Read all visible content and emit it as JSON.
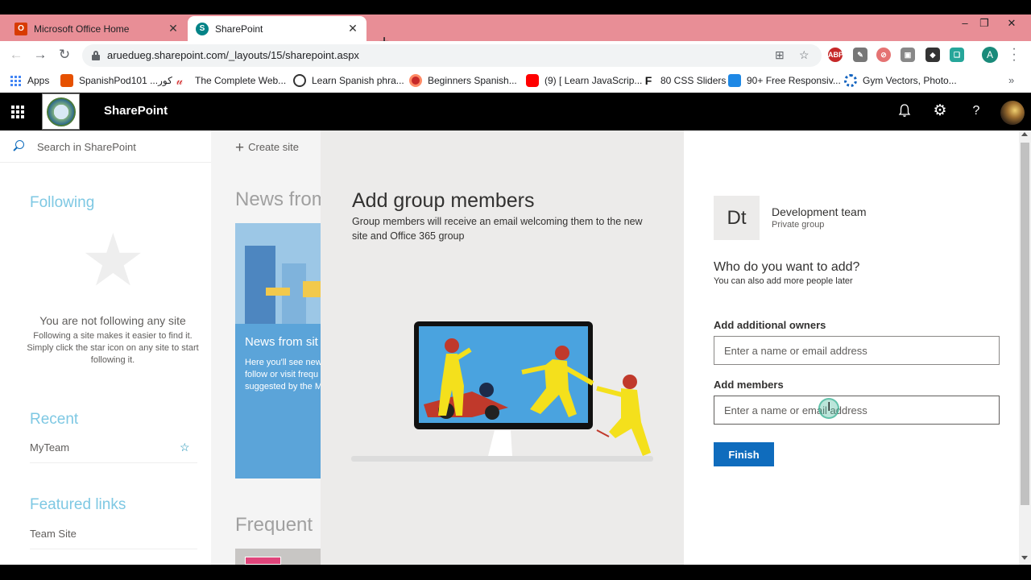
{
  "browser": {
    "tabs": [
      {
        "title": "Microsoft Office Home",
        "favicon": "office-icon",
        "active": false
      },
      {
        "title": "SharePoint",
        "favicon": "sharepoint-icon",
        "active": true
      }
    ],
    "url": "aruedueg.sharepoint.com/_layouts/15/sharepoint.aspx",
    "bookmarks": [
      {
        "label": "Apps",
        "icon": "apps-grid-icon"
      },
      {
        "label": "SpanishPod101 ...كور",
        "icon": "spanishpod-icon"
      },
      {
        "label": "The Complete Web...",
        "icon": "udemy-icon"
      },
      {
        "label": "Learn Spanish phra...",
        "icon": "globe-icon"
      },
      {
        "label": "Beginners Spanish...",
        "icon": "record-icon"
      },
      {
        "label": "(9) [ Learn JavaScrip...",
        "icon": "youtube-icon"
      },
      {
        "label": "80 CSS Sliders",
        "icon": "f-icon"
      },
      {
        "label": "90+ Free Responsiv...",
        "icon": "freebie-icon"
      },
      {
        "label": "Gym Vectors, Photo...",
        "icon": "gear-blue-icon"
      }
    ],
    "profile_initial": "A"
  },
  "header": {
    "app_title": "SharePoint"
  },
  "left_nav": {
    "search_placeholder": "Search in SharePoint",
    "following_heading": "Following",
    "empty_title": "You are not following any site",
    "empty_desc": "Following a site makes it easier to find it. Simply click the star icon on any site to start following it.",
    "recent_heading": "Recent",
    "recent_items": [
      "MyTeam"
    ],
    "featured_heading": "Featured links",
    "featured_items": [
      "Team Site"
    ]
  },
  "main": {
    "create_site_label": "Create site",
    "news_heading": "News from",
    "news_card_title": "News from sit",
    "news_card_desc_lines": [
      "Here you'll see new",
      "follow or visit frequ",
      "suggested by the M"
    ],
    "frequent_heading": "Frequent"
  },
  "panel": {
    "title": "Add group members",
    "subtitle": "Group members will receive an email welcoming them to the new site and Office 365 group",
    "group_initials": "Dt",
    "group_name": "Development team",
    "group_type": "Private group",
    "who_title": "Who do you want to add?",
    "who_sub": "You can also add more people later",
    "owners_label": "Add additional owners",
    "owners_placeholder": "Enter a name or email address",
    "members_label": "Add members",
    "members_placeholder": "Enter a name or email address",
    "finish_label": "Finish"
  },
  "colors": {
    "accent": "#0f6cbd",
    "tab_strip": "#e88e96",
    "nav_heading": "#7ec8e3",
    "panel_bg": "#ecebea"
  }
}
